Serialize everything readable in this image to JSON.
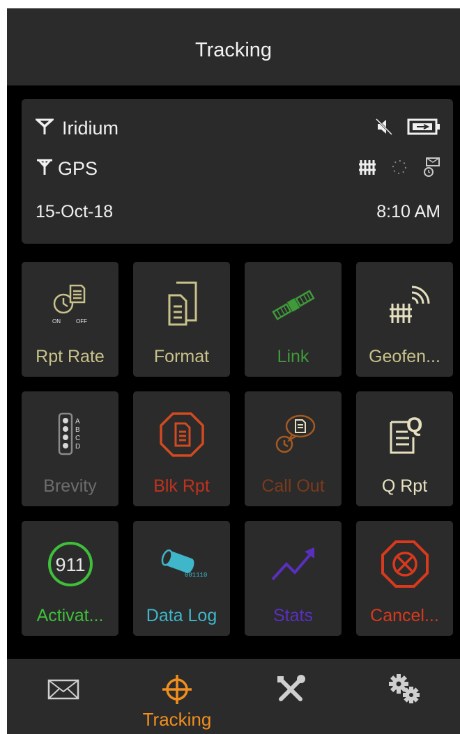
{
  "header": {
    "title": "Tracking"
  },
  "status": {
    "iridium_label": "Iridium",
    "gps_label": "GPS",
    "date": "15-Oct-18",
    "time": "8:10 AM",
    "icons": [
      "antenna-icon",
      "muted-speaker-icon",
      "battery-plugged-icon",
      "gps-antenna-icon",
      "geofence-icon",
      "dotted-circle-icon",
      "message-timer-icon"
    ]
  },
  "tiles": [
    {
      "label": "Rpt Rate",
      "color": "#c9c28a",
      "icon": "clock-report-icon",
      "on": "ON",
      "off": "OFF"
    },
    {
      "label": "Format",
      "color": "#c9c28a",
      "icon": "document-icon"
    },
    {
      "label": "Link",
      "color": "#3f9a3a",
      "icon": "satellite-icon"
    },
    {
      "label": "Geofen...",
      "color": "#c9c28a",
      "icon": "geofence-signal-icon"
    },
    {
      "label": "Brevity",
      "color": "#6d6d6d",
      "icon": "brevity-icon",
      "letters": [
        "A",
        "B",
        "C",
        "D"
      ]
    },
    {
      "label": "Blk Rpt",
      "color": "#c0321c",
      "icon": "block-report-icon"
    },
    {
      "label": "Call Out",
      "color": "#7a3a1c",
      "icon": "call-out-icon"
    },
    {
      "label": "Q Rpt",
      "color": "#e8e2c0",
      "icon": "q-report-icon",
      "q": "Q"
    },
    {
      "label": "Activat...",
      "color": "#3fbf3a",
      "icon": "emergency-911-icon",
      "badge": "911"
    },
    {
      "label": "Data Log",
      "color": "#3fb6c9",
      "icon": "data-log-icon",
      "binary": "001110"
    },
    {
      "label": "Stats",
      "color": "#5a2fc0",
      "icon": "stats-trend-icon"
    },
    {
      "label": "Cancel...",
      "color": "#d9391c",
      "icon": "cancel-icon"
    }
  ],
  "bottom_nav": {
    "tracking_label": "Tracking",
    "active_color": "#f08f1e",
    "items": [
      "mail-icon",
      "crosshair-icon",
      "tools-icon",
      "gears-icon"
    ]
  }
}
